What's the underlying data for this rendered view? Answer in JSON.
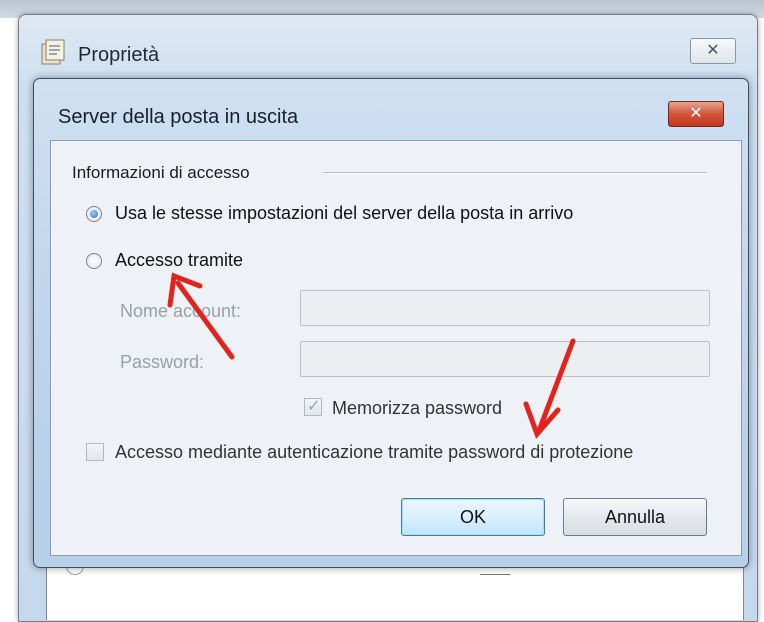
{
  "outer_window": {
    "title": "Proprietà",
    "close_glyph": "✕"
  },
  "dialog": {
    "title": "Server della posta in uscita",
    "close_glyph": "✕",
    "group_label": "Informazioni di accesso",
    "option_same_settings": "Usa le stesse impostazioni del server della posta in arrivo",
    "option_access_via": "Accesso tramite",
    "account_name_label": "Nome account:",
    "account_name_value": "",
    "password_label": "Password:",
    "password_value": "",
    "remember_password_label": "Memorizza password",
    "spa_label": "Accesso mediante autenticazione tramite password di protezione",
    "ok_label": "OK",
    "cancel_label": "Annulla"
  },
  "state": {
    "selected_option": "same_settings",
    "remember_password_checked": true,
    "spa_checked": false
  },
  "colors": {
    "annotation_arrow": "#e3231b",
    "accent": "#2a6fb8"
  }
}
